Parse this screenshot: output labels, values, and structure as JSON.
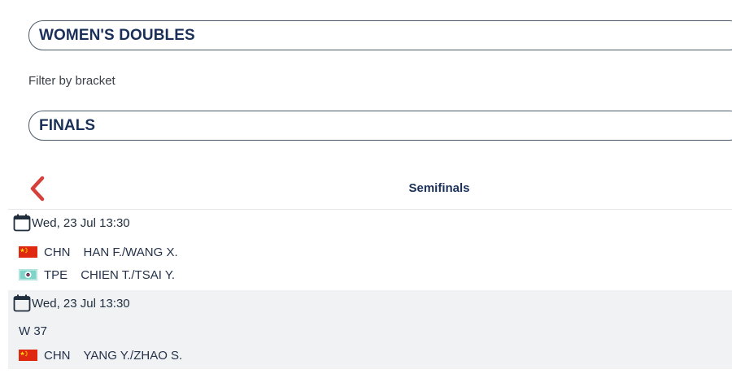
{
  "event_select": {
    "label": "WOMEN'S DOUBLES"
  },
  "filter": {
    "label": "Filter by bracket"
  },
  "bracket_select": {
    "label": "FINALS"
  },
  "round": {
    "title": "Semifinals"
  },
  "colors": {
    "brand_navy": "#1b3058",
    "accent_red": "#d6403a",
    "row_shade": "#f1f2f3"
  },
  "matches": [
    {
      "datetime": "Wed, 23 Jul  13:30",
      "teams": [
        {
          "noc": "CHN",
          "players": "HAN F./WANG X.",
          "flag": "china-flag"
        },
        {
          "noc": "TPE",
          "players": "CHIEN T./TSAI Y.",
          "flag": "chinese-taipei-flag"
        }
      ]
    },
    {
      "datetime": "Wed, 23 Jul  13:30",
      "placeholder": "W 37",
      "teams": [
        {
          "noc": "CHN",
          "players": "YANG Y./ZHAO S.",
          "flag": "china-flag"
        }
      ]
    }
  ]
}
